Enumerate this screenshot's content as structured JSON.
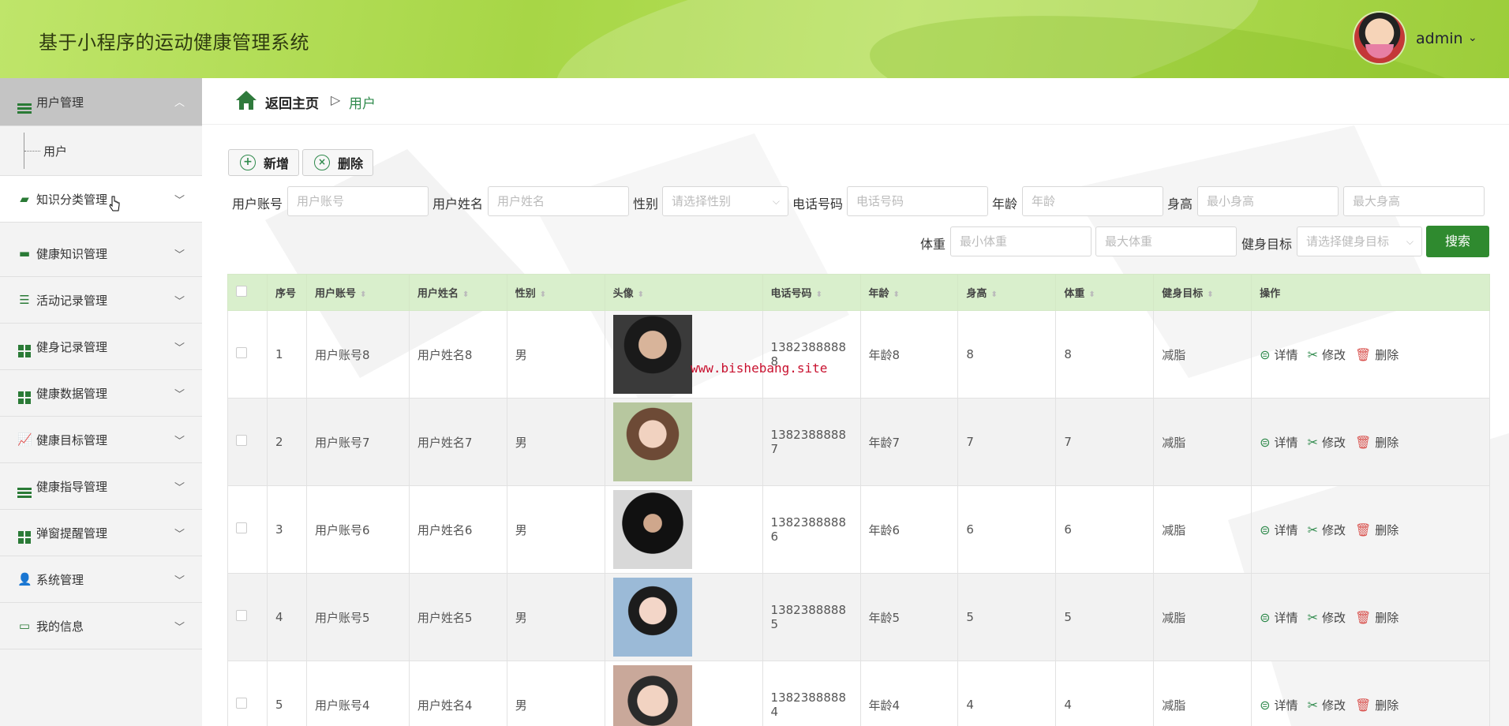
{
  "app": {
    "title": "基于小程序的运动健康管理系统",
    "user": "admin"
  },
  "sidebar": {
    "groups": [
      {
        "label": "用户管理",
        "icon": "bars-icon"
      },
      {
        "label": "知识分类管理",
        "icon": "folder-icon"
      },
      {
        "label": "健康知识管理",
        "icon": "monitor-icon"
      },
      {
        "label": "活动记录管理",
        "icon": "sliders-icon"
      },
      {
        "label": "健身记录管理",
        "icon": "grid-icon"
      },
      {
        "label": "健康数据管理",
        "icon": "grid-icon"
      },
      {
        "label": "健康目标管理",
        "icon": "chart-icon"
      },
      {
        "label": "健康指导管理",
        "icon": "list-icon"
      },
      {
        "label": "弹窗提醒管理",
        "icon": "grid-icon"
      },
      {
        "label": "系统管理",
        "icon": "person-icon"
      },
      {
        "label": "我的信息",
        "icon": "card-icon"
      }
    ],
    "sub_items": [
      {
        "label": "用户"
      }
    ]
  },
  "breadcrumb": {
    "home": "返回主页",
    "separator": "▷",
    "current": "用户"
  },
  "toolbar": {
    "add": "新增",
    "delete": "删除"
  },
  "filters": {
    "account_label": "用户账号",
    "account_placeholder": "用户账号",
    "name_label": "用户姓名",
    "name_placeholder": "用户姓名",
    "gender_label": "性别",
    "gender_placeholder": "请选择性别",
    "phone_label": "电话号码",
    "phone_placeholder": "电话号码",
    "age_label": "年龄",
    "age_placeholder": "年龄",
    "height_label": "身高",
    "height_min_placeholder": "最小身高",
    "height_max_placeholder": "最大身高",
    "weight_label": "体重",
    "weight_min_placeholder": "最小体重",
    "weight_max_placeholder": "最大体重",
    "goal_label": "健身目标",
    "goal_placeholder": "请选择健身目标",
    "search": "搜索"
  },
  "table": {
    "headers": [
      "序号",
      "用户账号",
      "用户姓名",
      "性别",
      "头像",
      "电话号码",
      "年龄",
      "身高",
      "体重",
      "健身目标",
      "操作"
    ],
    "actions": {
      "detail": "详情",
      "edit": "修改",
      "delete": "删除"
    },
    "rows": [
      {
        "index": "1",
        "account": "用户账号8",
        "name": "用户姓名8",
        "gender": "男",
        "phone_a": "1382388888",
        "phone_b": "8",
        "age": "年龄8",
        "height": "8",
        "weight": "8",
        "goal": "减脂"
      },
      {
        "index": "2",
        "account": "用户账号7",
        "name": "用户姓名7",
        "gender": "男",
        "phone_a": "1382388888",
        "phone_b": "7",
        "age": "年龄7",
        "height": "7",
        "weight": "7",
        "goal": "减脂"
      },
      {
        "index": "3",
        "account": "用户账号6",
        "name": "用户姓名6",
        "gender": "男",
        "phone_a": "1382388888",
        "phone_b": "6",
        "age": "年龄6",
        "height": "6",
        "weight": "6",
        "goal": "减脂"
      },
      {
        "index": "4",
        "account": "用户账号5",
        "name": "用户姓名5",
        "gender": "男",
        "phone_a": "1382388888",
        "phone_b": "5",
        "age": "年龄5",
        "height": "5",
        "weight": "5",
        "goal": "减脂"
      },
      {
        "index": "5",
        "account": "用户账号4",
        "name": "用户姓名4",
        "gender": "男",
        "phone_a": "1382388888",
        "phone_b": "4",
        "age": "年龄4",
        "height": "4",
        "weight": "4",
        "goal": "减脂"
      }
    ]
  },
  "watermark": "www.bishebang.site",
  "colors": {
    "primary": "#2f8a2f",
    "header_green": "#a7d646",
    "table_head": "#d9efcc"
  }
}
